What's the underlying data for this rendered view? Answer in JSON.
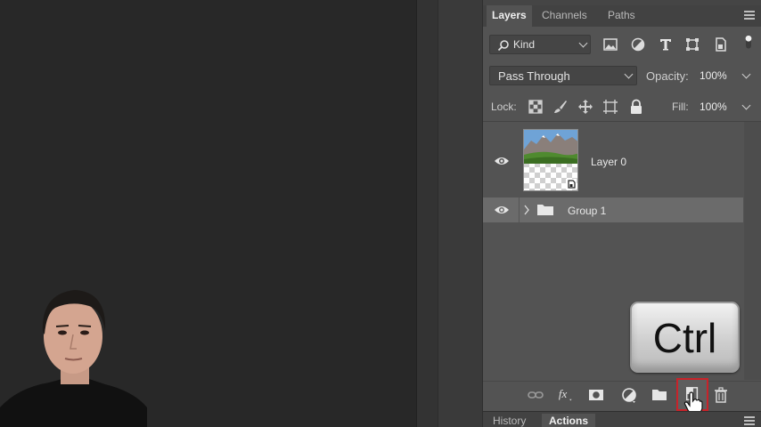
{
  "panel_tabs": [
    "Layers",
    "Channels",
    "Paths"
  ],
  "filter": {
    "kind_label": "Kind",
    "icons": [
      "image-filter-icon",
      "adjustment-filter-icon",
      "type-filter-icon",
      "shape-filter-icon",
      "smart-object-filter-icon",
      "filter-toggle-icon"
    ]
  },
  "blend": {
    "mode": "Pass Through",
    "opacity_label": "Opacity:",
    "opacity_value": "100%"
  },
  "lock": {
    "label": "Lock:",
    "fill_label": "Fill:",
    "fill_value": "100%",
    "icons": [
      "lock-transparent-pixels-icon",
      "lock-image-pixels-icon",
      "lock-position-icon",
      "lock-artboard-icon",
      "lock-all-icon"
    ]
  },
  "layers": [
    {
      "name": "Layer 0",
      "visible": true,
      "selected": false,
      "type": "smart-object"
    },
    {
      "name": "Group 1",
      "visible": true,
      "selected": true,
      "type": "group"
    }
  ],
  "bottom_toolbar": {
    "icons": [
      "link-layers-icon",
      "fx-icon",
      "add-mask-icon",
      "adjustment-layer-icon",
      "new-group-icon",
      "new-layer-icon",
      "delete-icon"
    ],
    "highlighted": "new-layer-icon"
  },
  "lower_tabs": [
    "History",
    "Actions"
  ],
  "lower_active_tab": "Actions",
  "key_overlay": "Ctrl",
  "colors": {
    "panel": "#535353",
    "selected_row": "#6b6b6b",
    "highlight_border": "#c8232a",
    "workspace": "#282828"
  }
}
